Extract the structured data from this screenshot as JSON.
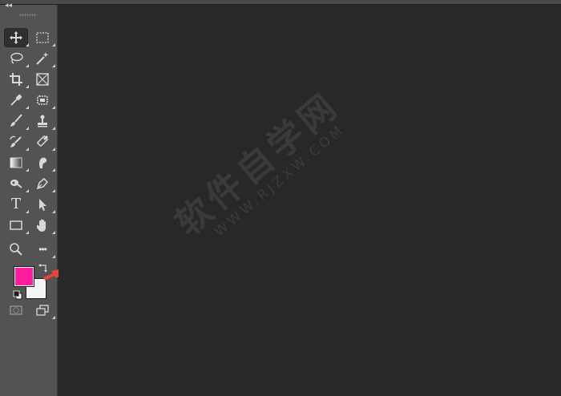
{
  "panel": {
    "collapse_glyph": "◂◂"
  },
  "tools": [
    {
      "id": "move",
      "icon": "move-icon",
      "active": true
    },
    {
      "id": "rect-marquee",
      "icon": "rectangular-marquee-icon"
    },
    {
      "id": "lasso",
      "icon": "lasso-icon"
    },
    {
      "id": "magic-wand",
      "icon": "magic-wand-icon"
    },
    {
      "id": "crop",
      "icon": "crop-icon"
    },
    {
      "id": "frame",
      "icon": "frame-icon"
    },
    {
      "id": "eyedropper",
      "icon": "eyedropper-icon"
    },
    {
      "id": "healing",
      "icon": "spot-healing-icon"
    },
    {
      "id": "brush",
      "icon": "brush-icon"
    },
    {
      "id": "stamp",
      "icon": "clone-stamp-icon"
    },
    {
      "id": "history-brush",
      "icon": "history-brush-icon"
    },
    {
      "id": "eraser",
      "icon": "eraser-icon"
    },
    {
      "id": "gradient",
      "icon": "gradient-icon"
    },
    {
      "id": "smudge",
      "icon": "smudge-icon"
    },
    {
      "id": "dodge",
      "icon": "dodge-icon"
    },
    {
      "id": "pen",
      "icon": "pen-icon"
    },
    {
      "id": "type",
      "icon": "type-icon",
      "glyph": "T"
    },
    {
      "id": "path-select",
      "icon": "path-selection-icon"
    },
    {
      "id": "rectangle",
      "icon": "rectangle-shape-icon"
    },
    {
      "id": "hand",
      "icon": "hand-icon"
    },
    {
      "id": "zoom",
      "icon": "zoom-icon"
    },
    {
      "id": "more",
      "icon": "more-tools-icon",
      "glyph": "•••"
    },
    {
      "id": "quick-mask",
      "icon": "quick-mask-icon"
    },
    {
      "id": "screen-mode",
      "icon": "screen-mode-icon"
    }
  ],
  "colors": {
    "foreground": "#ff1f9e",
    "background": "#f4f4f4",
    "arrow": "#e8453c"
  },
  "watermark": {
    "cn": "软件自学网",
    "en": "WWW.RJZXW.COM"
  }
}
